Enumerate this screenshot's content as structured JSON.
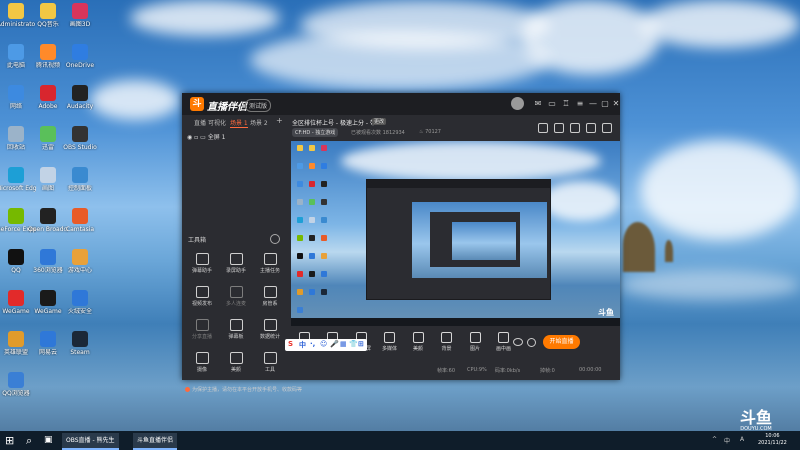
{
  "colors": {
    "accent": "#ff7a00",
    "active_tab": "#ff6a3d",
    "panel_bg": "#2b2c31"
  },
  "desktop_icons": [
    {
      "label": "Administrato",
      "color": "#f2c744",
      "icon": "folder-icon"
    },
    {
      "label": "QQ音乐",
      "color": "#f2c744",
      "icon": "qq-music-icon"
    },
    {
      "label": "画图3D",
      "color": "#d8355b",
      "icon": "paint3d-icon"
    },
    {
      "label": "此电脑",
      "color": "#4d9ae6",
      "icon": "computer-icon"
    },
    {
      "label": "腾讯视频",
      "color": "#ff8a2a",
      "icon": "tencent-video-icon"
    },
    {
      "label": "OneDrive",
      "color": "#2f7de1",
      "icon": "onedrive-icon"
    },
    {
      "label": "网络",
      "color": "#3d8ae0",
      "icon": "network-icon"
    },
    {
      "label": "Adobe",
      "color": "#d8262e",
      "icon": "adobe-icon"
    },
    {
      "label": "Audacity",
      "color": "#222222",
      "icon": "audacity-icon"
    },
    {
      "label": "回收站",
      "color": "#9bb3c9",
      "icon": "recycle-bin-icon"
    },
    {
      "label": "迅雷",
      "color": "#5ac05a",
      "icon": "xunlei-icon"
    },
    {
      "label": "OBS Studio",
      "color": "#333333",
      "icon": "obs-icon"
    },
    {
      "label": "Microsoft Edge",
      "color": "#1d9fd6",
      "icon": "edge-icon"
    },
    {
      "label": "画图",
      "color": "#c2d3e6",
      "icon": "paint-icon"
    },
    {
      "label": "控制面板",
      "color": "#3a8ad0",
      "icon": "control-panel-icon"
    },
    {
      "label": "GeForce Experience",
      "color": "#76b900",
      "icon": "geforce-icon"
    },
    {
      "label": "Open Broadcaster",
      "color": "#222222",
      "icon": "obs-icon-2"
    },
    {
      "label": "Camtasia",
      "color": "#e85b28",
      "icon": "camtasia-icon"
    },
    {
      "label": "QQ",
      "color": "#111111",
      "icon": "qq-icon"
    },
    {
      "label": "360浏览器",
      "color": "#2f78d8",
      "icon": "browser-icon"
    },
    {
      "label": "游戏中心",
      "color": "#e8a13a",
      "icon": "game-center-icon"
    },
    {
      "label": "WeGame",
      "color": "#e22a2a",
      "icon": "wegame-icon"
    },
    {
      "label": "WeGame",
      "color": "#1a1a1a",
      "icon": "wegame-icon-2"
    },
    {
      "label": "火绒安全",
      "color": "#2f78d8",
      "icon": "security-icon"
    },
    {
      "label": "英雄联盟",
      "color": "#e09b2b",
      "icon": "lol-icon"
    },
    {
      "label": "网易云",
      "color": "#2f78d8",
      "icon": "netease-icon"
    },
    {
      "label": "Steam",
      "color": "#1b2838",
      "icon": "steam-icon"
    },
    {
      "label": "QQ浏览器",
      "color": "#3a7fd5",
      "icon": "qq-browser-icon"
    }
  ],
  "app": {
    "name": "直播伴侣",
    "version": "测试版",
    "tabs": [
      "直播",
      "可视化",
      "场景 1",
      "场景 2"
    ],
    "add_tab": "+",
    "scene_item": "全屏 1",
    "toolbox_title": "工具箱",
    "tools": [
      {
        "label": "弹幕助手"
      },
      {
        "label": "录屏助手"
      },
      {
        "label": "主播任务"
      },
      {
        "label": "视频发布",
        "dim": false
      },
      {
        "label": "多人连麦",
        "dim": true
      },
      {
        "label": "房管系"
      },
      {
        "label": "分享直播",
        "dim": true
      },
      {
        "label": "弹幕板"
      },
      {
        "label": "数据统计"
      },
      {
        "label": "摄像"
      },
      {
        "label": "美颜"
      },
      {
        "label": "工具"
      }
    ],
    "notice": "为保护主播，请勿在本平台开放手机号、收款码等",
    "room_title": "全区排位杯上号 - 极速上分 - 带",
    "room_badge": "更改",
    "category": "CF:HD - 独立游戏",
    "meta1": "已被观看次数  1812934",
    "meta2": "70127",
    "bottom_buttons": [
      "直播屏幕",
      "摄像头",
      "手机投屏",
      "多媒体",
      "美颜",
      "背景",
      "图片",
      "画中画"
    ],
    "live_button": "开始直播",
    "stats": [
      "帧率:60",
      "CPU:9%",
      "码率:0kb/s",
      "掉帧:0",
      "00:00:00"
    ],
    "watermark_top": "斗鱼",
    "watermark_bottom": "DOUYU.COM"
  },
  "ime": {
    "logo": "S",
    "items": [
      "中",
      "·,",
      "☺",
      "🎤",
      "▦",
      "👕",
      "⊞"
    ]
  },
  "taskbar": {
    "start": "⊞",
    "search": "⌕",
    "tasks": [
      "OBS直播 - 熊先生",
      "斗鱼直播伴侣"
    ],
    "tray": [
      "^",
      "中",
      "A"
    ],
    "time": "10:06",
    "date": "2021/11/22"
  }
}
